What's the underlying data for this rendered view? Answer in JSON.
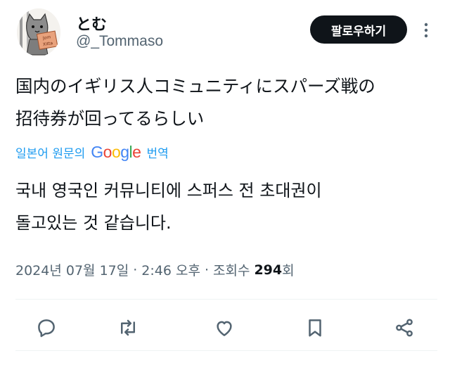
{
  "user": {
    "name": "とむ",
    "handle": "@_Tommaso",
    "avatar_sign_text": "Jom Xitta"
  },
  "follow_button_label": "팔로우하기",
  "tweet": {
    "lines": [
      "国内のイギリス人コミュニティにスパーズ戦の",
      "招待券が回ってるらしい"
    ]
  },
  "translation": {
    "prefix": "일본어 원문의",
    "brand": "Google",
    "suffix": "번역",
    "lines": [
      "국내 영국인 커뮤니티에 스퍼스 전 초대권이",
      "돌고있는 것 같습니다."
    ]
  },
  "meta": {
    "date": "2024년 07월 17일",
    "separator": "·",
    "time": "2:46 오후",
    "views_label": "조회수",
    "views_count": "294",
    "views_suffix": "회"
  },
  "icons": {
    "more": "more-vertical-icon",
    "reply": "reply-icon",
    "retweet": "retweet-icon",
    "like": "heart-icon",
    "bookmark": "bookmark-icon",
    "share": "share-icon"
  },
  "colors": {
    "accent_link": "#1d9bf0",
    "follow_button_bg": "#0f1419",
    "secondary_text": "#536471",
    "primary_text": "#0f1419"
  }
}
